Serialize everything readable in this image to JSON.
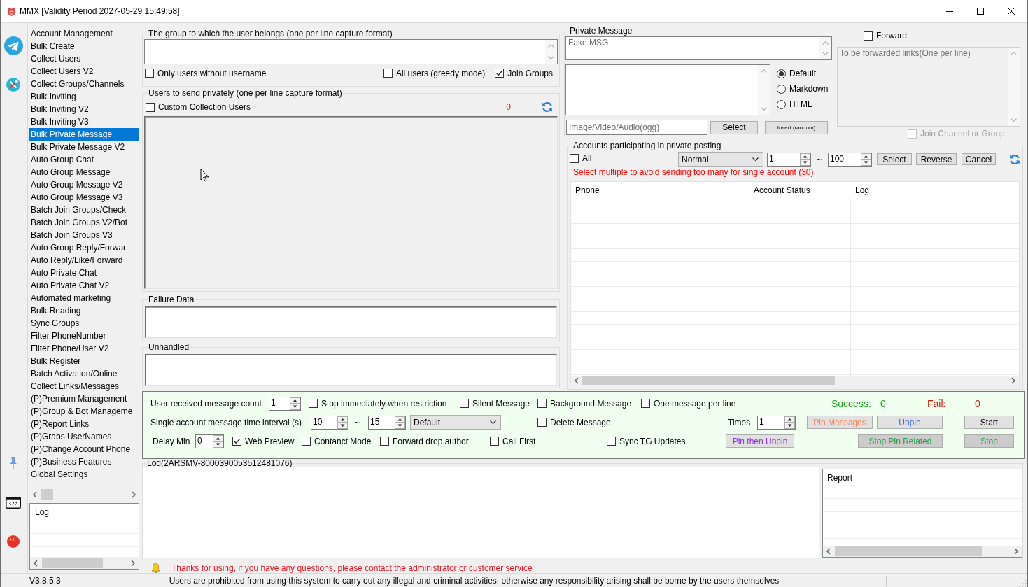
{
  "window": {
    "title": "MMX [Validity Period 2027-05-29 15:49:58]"
  },
  "sidebar": {
    "items": [
      {
        "label": "Account Management",
        "selected": false
      },
      {
        "label": "Bulk Create",
        "selected": false
      },
      {
        "label": "Collect Users",
        "selected": false
      },
      {
        "label": "Collect Users V2",
        "selected": false
      },
      {
        "label": "Collect Groups/Channels",
        "selected": false
      },
      {
        "label": "Bulk Inviting",
        "selected": false
      },
      {
        "label": "Bulk Inviting V2",
        "selected": false
      },
      {
        "label": "Bulk Inviting V3",
        "selected": false
      },
      {
        "label": "Bulk Private Message",
        "selected": true
      },
      {
        "label": "Bulk Private Message V2",
        "selected": false
      },
      {
        "label": "Auto Group Chat",
        "selected": false
      },
      {
        "label": "Auto Group Message",
        "selected": false
      },
      {
        "label": "Auto Group Message V2",
        "selected": false
      },
      {
        "label": "Auto Group Message V3",
        "selected": false
      },
      {
        "label": "Batch Join Groups/Check",
        "selected": false
      },
      {
        "label": "Batch Join Groups V2/Bot",
        "selected": false
      },
      {
        "label": "Batch Join Groups V3",
        "selected": false
      },
      {
        "label": "Auto Group Reply/Forwar",
        "selected": false
      },
      {
        "label": "Auto Reply/Like/Forward",
        "selected": false
      },
      {
        "label": "Auto Private Chat",
        "selected": false
      },
      {
        "label": "Auto Private Chat V2",
        "selected": false
      },
      {
        "label": "Automated marketing",
        "selected": false
      },
      {
        "label": "Bulk Reading",
        "selected": false
      },
      {
        "label": "Sync Groups",
        "selected": false
      },
      {
        "label": "Filter PhoneNumber",
        "selected": false
      },
      {
        "label": "Filter Phone/User V2",
        "selected": false
      },
      {
        "label": "Bulk Register",
        "selected": false
      },
      {
        "label": "Batch Activation/Online",
        "selected": false
      },
      {
        "label": "Collect Links/Messages",
        "selected": false
      },
      {
        "label": "(P)Premium Management",
        "selected": false
      },
      {
        "label": "(P)Group & Bot Manageme",
        "selected": false
      },
      {
        "label": "(P)Report Links",
        "selected": false
      },
      {
        "label": "(P)Grabs UserNames",
        "selected": false
      },
      {
        "label": "(P)Change Account Phone",
        "selected": false
      },
      {
        "label": "(P)Business Features",
        "selected": false
      },
      {
        "label": "Global Settings",
        "selected": false
      }
    ],
    "log": {
      "columns": [
        "Log"
      ]
    }
  },
  "group_source": {
    "title": "The group to which the user belongs (one per line capture format)",
    "options": [
      {
        "label": "Only users without username",
        "checked": false
      },
      {
        "label": "All users (greedy mode)",
        "checked": false
      },
      {
        "label": "Join Groups",
        "checked": true
      }
    ]
  },
  "private_users": {
    "title": "Users to send privately (one per line capture format)",
    "custom": {
      "label": "Custom Collection Users",
      "checked": false
    },
    "count": "0"
  },
  "failure_data": {
    "title": "Failure Data"
  },
  "unhandled": {
    "title": "Unhandled"
  },
  "private_message": {
    "title": "Private Message",
    "text_placeholder": "Fake MSG",
    "formats": [
      {
        "label": "Default",
        "selected": true
      },
      {
        "label": "Markdown",
        "selected": false
      },
      {
        "label": "HTML",
        "selected": false
      }
    ],
    "media_placeholder": "Image/Video/Audio(ogg)",
    "select_button": "Select",
    "insert_button": "Insert (random)"
  },
  "forward": {
    "label": "Forward",
    "checked": false,
    "links": {
      "placeholder": "To be forwarded links(One per line)",
      "disabled": true
    },
    "join": {
      "label": "Join Channel or Group",
      "checked": false,
      "disabled": true
    }
  },
  "accounts": {
    "title": "Accounts participating in private posting",
    "all": {
      "label": "All",
      "checked": false
    },
    "mode": "Normal",
    "range_from": "1",
    "range_separator": "~",
    "range_to": "100",
    "buttons": [
      "Select",
      "Reverse",
      "Cancel"
    ],
    "warning": "Select multiple to avoid sending too many for single account (30)",
    "table": {
      "columns": [
        "Phone",
        "Account Status",
        "Log"
      ]
    }
  },
  "settings": {
    "rows": [
      {
        "items": [
          {
            "kind": "label",
            "text": "User received message count"
          },
          {
            "kind": "spin",
            "value": "1"
          },
          {
            "kind": "check",
            "label": "Stop immediately when restriction",
            "checked": false
          },
          {
            "kind": "check",
            "label": "Silent Message",
            "checked": false
          },
          {
            "kind": "check",
            "label": "Background Message",
            "checked": false
          },
          {
            "kind": "check",
            "label": "One message per line",
            "checked": false
          }
        ]
      },
      {
        "items": [
          {
            "kind": "label",
            "text": "Single account message time interval (s)"
          },
          {
            "kind": "spin",
            "value": "10"
          },
          {
            "kind": "label",
            "text": "~"
          },
          {
            "kind": "spin",
            "value": "15"
          },
          {
            "kind": "select",
            "value": "Default"
          },
          {
            "kind": "check",
            "label": "Delete Message",
            "checked": false
          },
          {
            "kind": "label",
            "text": "Times"
          },
          {
            "kind": "spin",
            "value": "1"
          }
        ]
      },
      {
        "items": [
          {
            "kind": "label",
            "text": "Delay Min"
          },
          {
            "kind": "spin",
            "value": "0"
          },
          {
            "kind": "check",
            "label": "Web Preview",
            "checked": true
          },
          {
            "kind": "check",
            "label": "Contanct Mode",
            "checked": false
          },
          {
            "kind": "check",
            "label": "Forward drop author",
            "checked": false
          },
          {
            "kind": "check",
            "label": "Call First",
            "checked": false
          },
          {
            "kind": "check",
            "label": "Sync TG Updates",
            "checked": false
          }
        ]
      }
    ],
    "stats": [
      {
        "label": "Success:",
        "value": "0",
        "color": "#1e9e1e"
      },
      {
        "label": "Fail:",
        "value": "0",
        "color": "#e51400"
      }
    ],
    "pin_buttons": [
      {
        "label": "Pin Messages",
        "color": "#ff7f50",
        "disabled": false
      },
      {
        "label": "Unpin",
        "color": "#4169e1",
        "disabled": false
      },
      {
        "label": "Pin then Unpin",
        "color": "#8a2be2",
        "disabled": false
      },
      {
        "label": "Stop Pin Related",
        "color": "#22a042",
        "disabled": true
      }
    ],
    "run_buttons": [
      {
        "label": "Start",
        "color": "#000000",
        "disabled": false
      },
      {
        "label": "Stop",
        "color": "#22a042",
        "disabled": true
      }
    ]
  },
  "log": {
    "title": "Log(2ARSMV-8000390053512481076)",
    "report": {
      "columns": [
        "Report"
      ]
    }
  },
  "notice": "Thanks for using, if you have any questions, please contact the administrator or customer service",
  "status_bar": {
    "version": "V3.8.5.3",
    "message": "Users are prohibited from using this system to carry out any illegal and criminal activities, otherwise any responsibility arising shall be borne by the users themselves"
  }
}
